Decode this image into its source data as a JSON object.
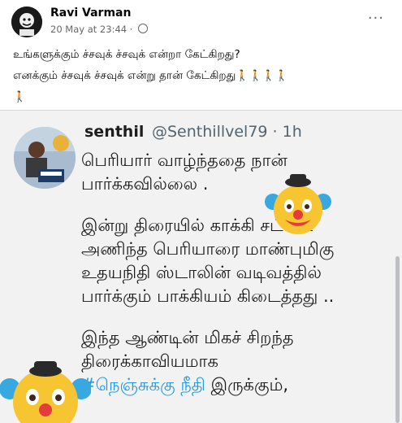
{
  "post": {
    "author": "Ravi Varman",
    "timestamp": "20 May at 23:44",
    "separator": "·",
    "more_label": "···",
    "line1": "உங்களுக்கும் ச்சவுக் ச்சவுக் என்றா கேட்கிறது?",
    "line2": "எனக்கும் ச்சவுக் ச்சவுக் என்று தான் கேட்கிறது",
    "walkers_line2": "🚶🚶🚶🚶",
    "walkers_line3": "🚶"
  },
  "tweet": {
    "name": "senthil",
    "handle": "@Senthillvel79 · 1h",
    "para1": [
      "பெரியார் வாழ்ந்ததை நான்",
      "பார்க்கவில்லை ."
    ],
    "para2": [
      "இன்று திரையில் காக்கி சட்டை",
      "அணிந்த பெரியாரை மாண்புமிகு",
      "உதயநிதி ஸ்டாலின் வடிவத்தில்",
      "பார்க்கும் பாக்கியம் கிடைத்தது .."
    ],
    "para3": [
      "இந்த ஆண்டின் மிகச் சிறந்த",
      "திரைக்காவியமாக"
    ],
    "hashtag": "#நெஞ்சுக்கு நீதி",
    "after_hashtag": " இருக்கும்,"
  },
  "icons": {
    "clown_1": "clown-face-icon",
    "clown_2": "clown-face-icon",
    "globe": "globe-icon"
  }
}
